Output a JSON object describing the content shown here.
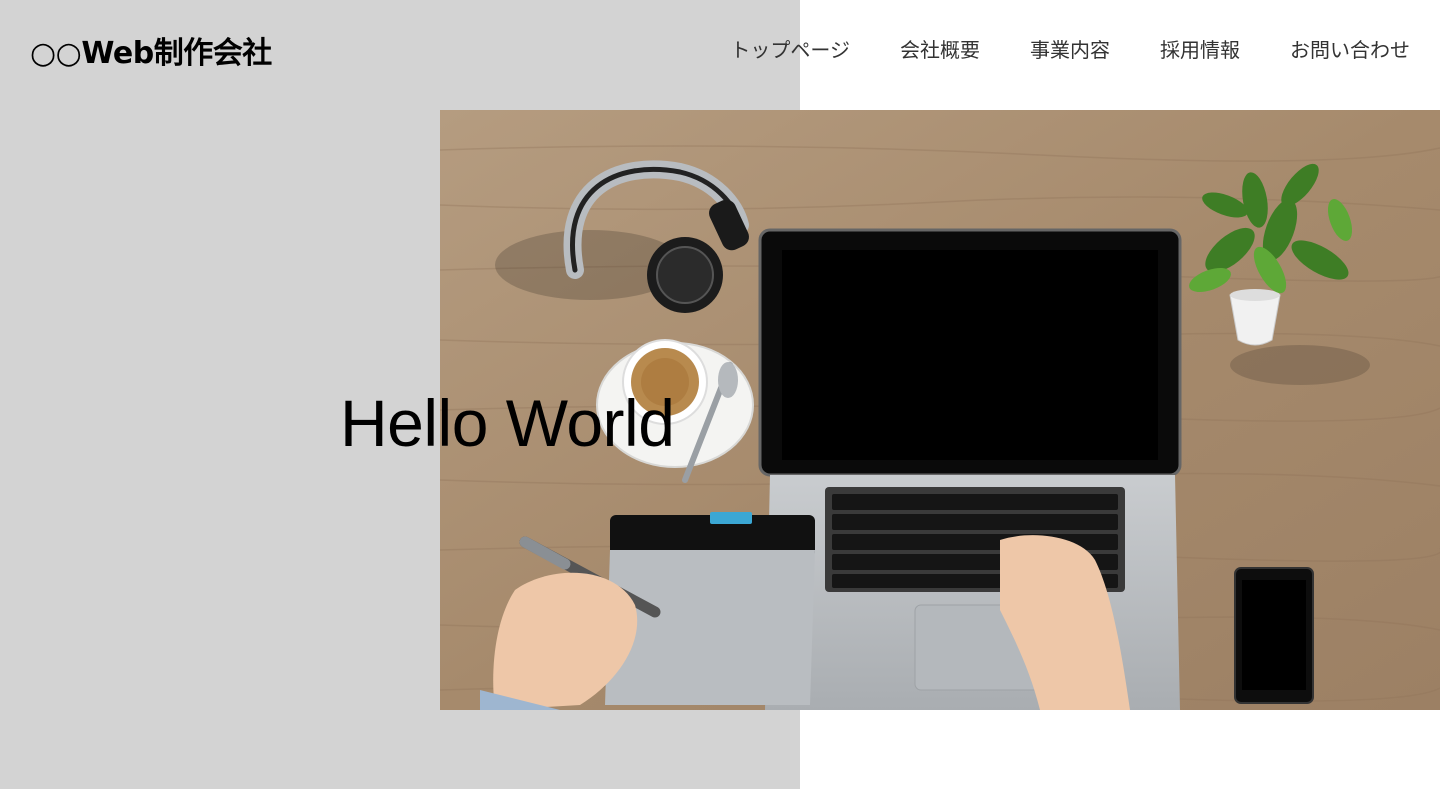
{
  "header": {
    "logo": "○○Web制作会社",
    "nav": [
      "トップページ",
      "会社概要",
      "事業内容",
      "採用情報",
      "お問い合わせ"
    ]
  },
  "hero": {
    "heading": "Hello World",
    "image_description_icons": [
      "headphones-icon",
      "coffee-cup-icon",
      "laptop-icon",
      "drawing-tablet-icon",
      "smartphone-icon",
      "plant-icon"
    ]
  },
  "colors": {
    "panel": "#d3d3d3",
    "background": "#ffffff",
    "nav_text": "#333333",
    "desk_wood": "#a88e72"
  }
}
